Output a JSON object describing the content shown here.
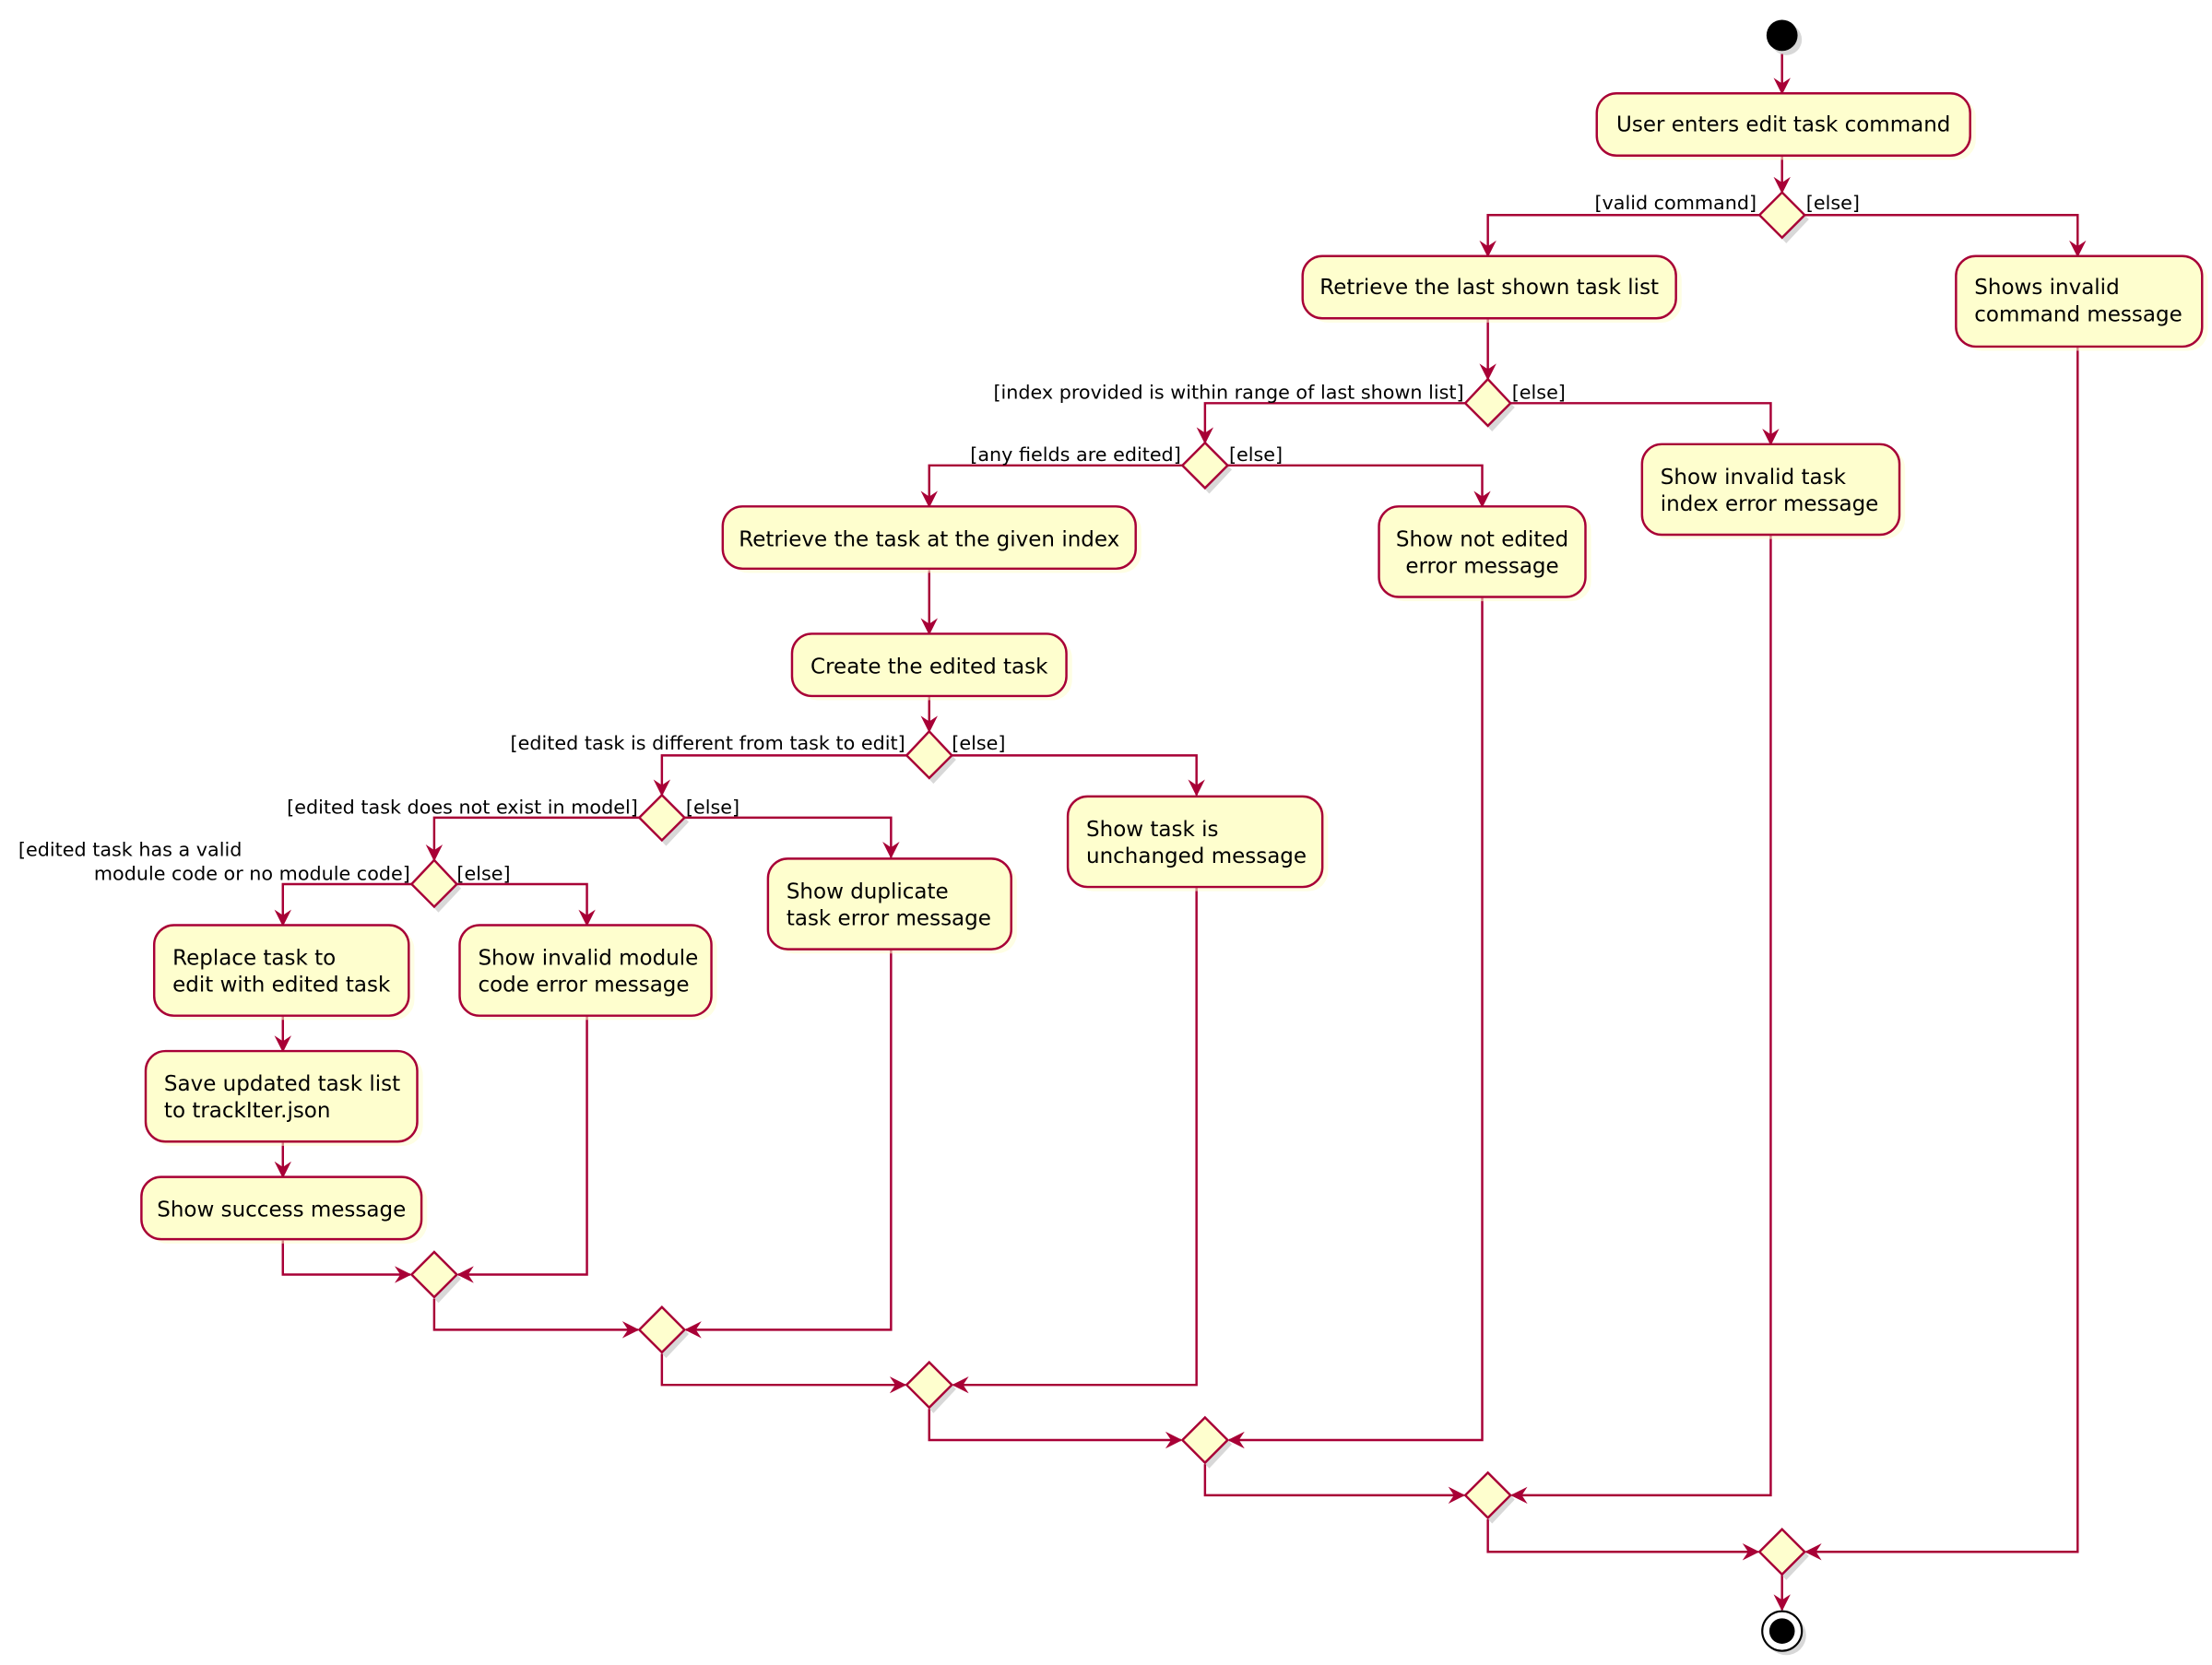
{
  "diagram": {
    "type": "UML activity diagram",
    "colors": {
      "line": "#A80036",
      "node_fill": "#FEFECE",
      "start_end": "#000000",
      "background": "#FFFFFF"
    },
    "activities": {
      "user_enters": [
        "User enters edit task command"
      ],
      "retrieve_list": [
        "Retrieve the last shown task list"
      ],
      "shows_invalid_command": [
        "Shows invalid",
        "command message"
      ],
      "show_invalid_index": [
        "Show invalid task",
        "index error message"
      ],
      "retrieve_task": [
        "Retrieve the task at the given index"
      ],
      "show_not_edited": [
        "Show not edited",
        "error message"
      ],
      "create_edited": [
        "Create the edited task"
      ],
      "show_unchanged": [
        "Show task is",
        "unchanged message"
      ],
      "show_duplicate": [
        "Show duplicate",
        "task error message"
      ],
      "replace_task": [
        "Replace task to",
        "edit with edited task"
      ],
      "show_invalid_module": [
        "Show invalid module",
        "code error message"
      ],
      "save_list": [
        "Save updated task list",
        "to trackIter.json"
      ],
      "show_success": [
        "Show success message"
      ]
    },
    "guards": {
      "valid_command": "[valid command]",
      "else_1": "[else]",
      "index_in_range": "[index provided is within range of last shown list]",
      "else_2": "[else]",
      "fields_edited": "[any fields are edited]",
      "else_3": "[else]",
      "task_different": "[edited task is different from task to edit]",
      "else_4": "[else]",
      "not_exist": "[edited task does not exist in model]",
      "else_5": "[else]",
      "valid_module_line1": "[edited task has a valid",
      "valid_module_line2": "module code or no module code]",
      "else_6": "[else]"
    }
  }
}
